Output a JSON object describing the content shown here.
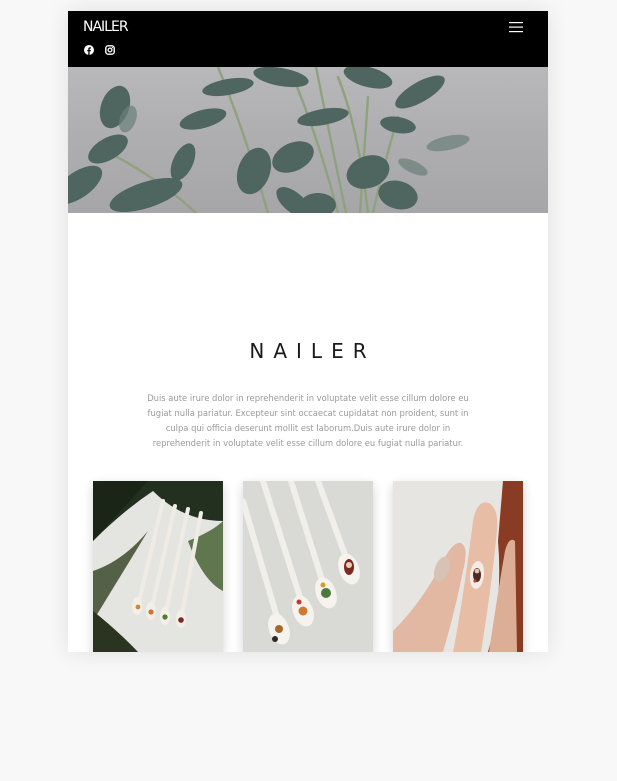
{
  "nav": {
    "brand": "NAILER",
    "social_icons": [
      "facebook-icon",
      "instagram-icon"
    ],
    "menu_icon": "hamburger-menu-icon"
  },
  "hero": {
    "image": "eucalyptus-leaves-photo"
  },
  "section": {
    "title": "NAILER",
    "description": "Duis aute irure dolor in reprehenderit in voluptate velit esse cillum dolore eu fugiat nulla pariatur. Excepteur sint occaecat cupidatat non proident, sunt in culpa qui officia deserunt mollit est laborum.Duis aute irure dolor in reprehenderit in voluptate velit esse cillum dolore eu fugiat nulla pariatur."
  },
  "gallery": [
    {
      "image": "nail-tips-on-sticks-with-palm-leaves-photo"
    },
    {
      "image": "painted-nail-tips-on-sticks-photo"
    },
    {
      "image": "hand-with-painted-nails-photo"
    }
  ],
  "colors": {
    "page_background": "#f8f8f8",
    "nav_background": "#000000",
    "nav_text": "#ffffff",
    "title_text": "#1a1a1a",
    "body_text": "#9a9a9a"
  }
}
